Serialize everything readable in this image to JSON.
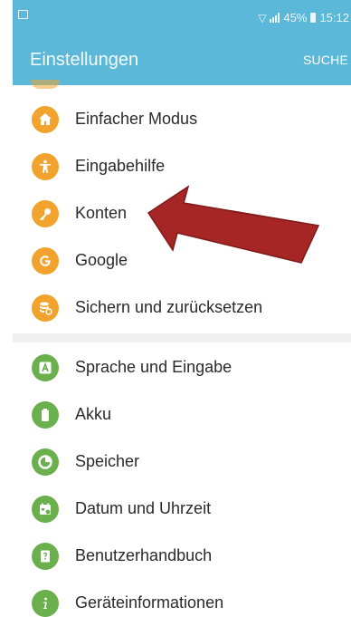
{
  "status": {
    "battery": "45%",
    "time": "15:12"
  },
  "header": {
    "title": "Einstellungen",
    "search": "SUCHE"
  },
  "groups": [
    {
      "items": [
        {
          "label": "Einfacher Modus",
          "icon": "easy-mode-icon",
          "color": "#f2a32e"
        },
        {
          "label": "Eingabehilfe",
          "icon": "accessibility-icon",
          "color": "#f2a32e"
        },
        {
          "label": "Konten",
          "icon": "key-icon",
          "color": "#f2a32e"
        },
        {
          "label": "Google",
          "icon": "google-icon",
          "color": "#f2a32e"
        },
        {
          "label": "Sichern und zurücksetzen",
          "icon": "backup-icon",
          "color": "#f2a32e"
        }
      ]
    },
    {
      "items": [
        {
          "label": "Sprache und Eingabe",
          "icon": "language-icon",
          "color": "#6ab04c"
        },
        {
          "label": "Akku",
          "icon": "battery-icon",
          "color": "#6ab04c"
        },
        {
          "label": "Speicher",
          "icon": "storage-icon",
          "color": "#6ab04c"
        },
        {
          "label": "Datum und Uhrzeit",
          "icon": "calendar-icon",
          "color": "#6ab04c"
        },
        {
          "label": "Benutzerhandbuch",
          "icon": "manual-icon",
          "color": "#6ab04c"
        },
        {
          "label": "Geräteinformationen",
          "icon": "info-icon",
          "color": "#6ab04c"
        }
      ]
    }
  ],
  "annotation": {
    "arrow_color": "#a62626",
    "target": "Konten"
  }
}
